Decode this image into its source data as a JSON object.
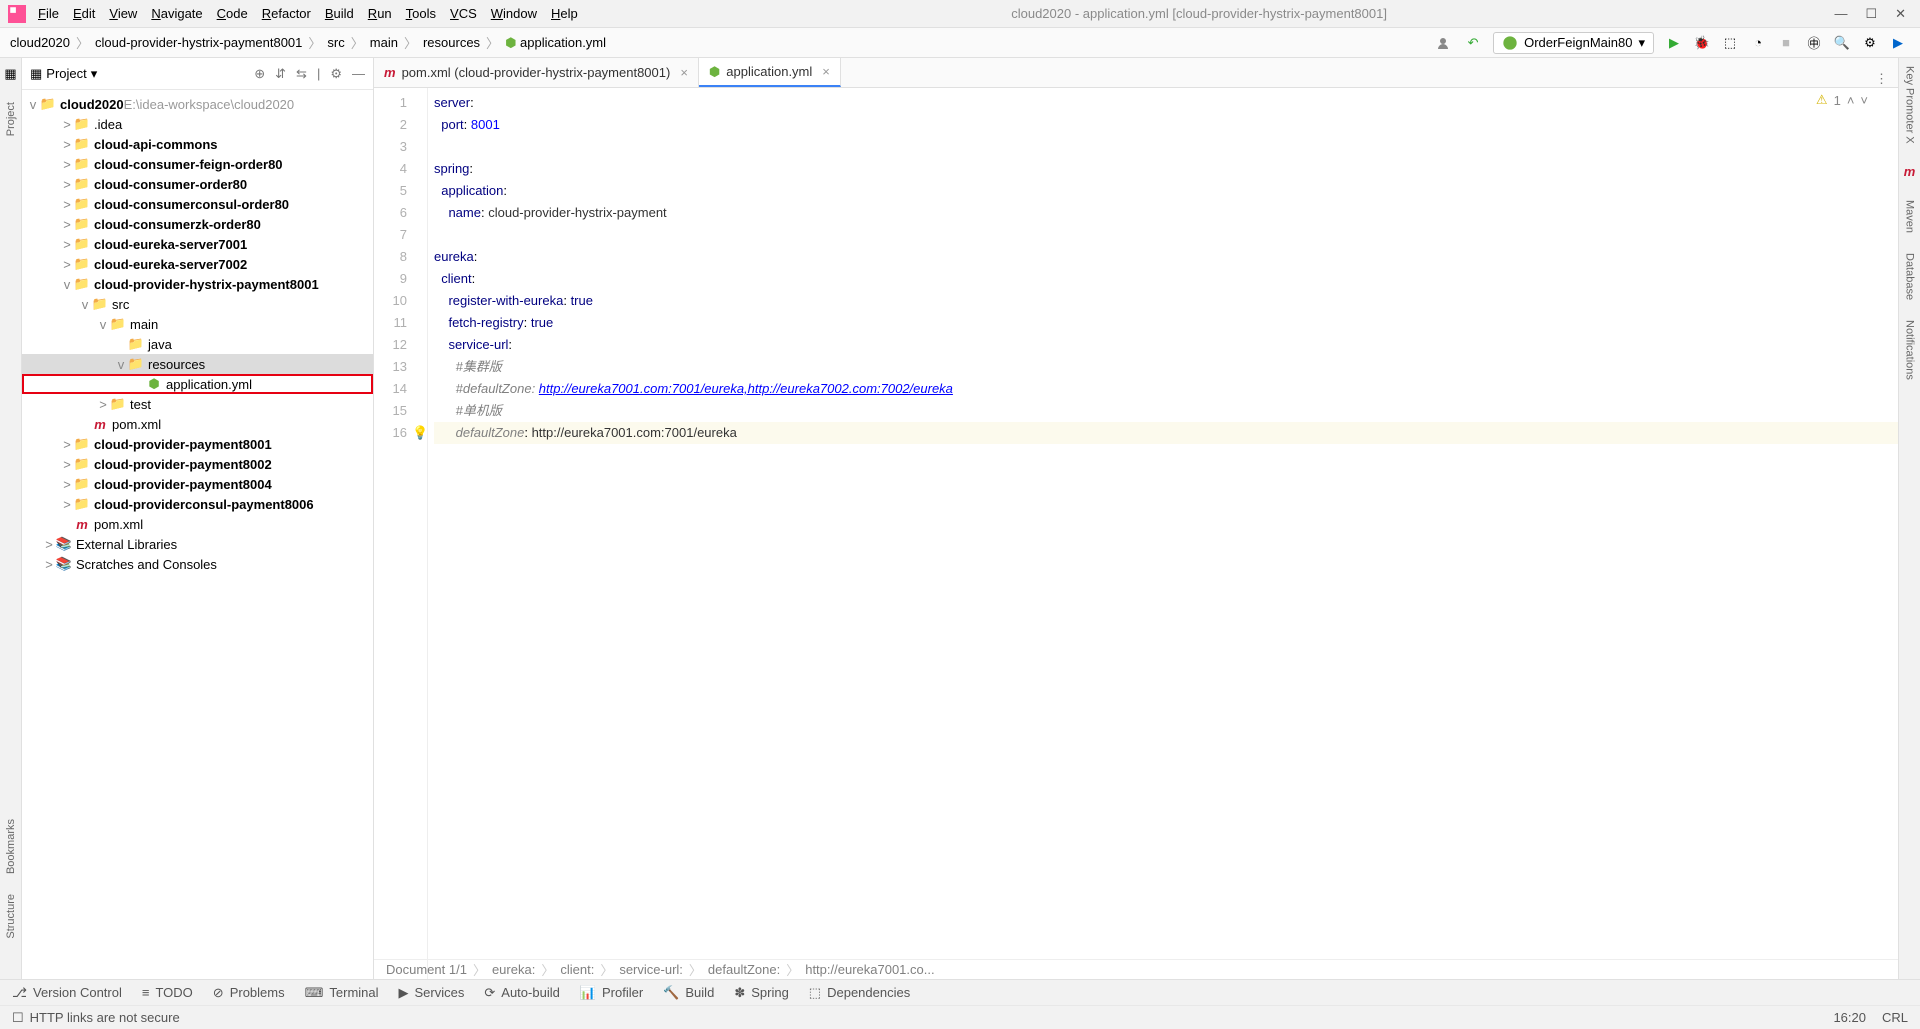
{
  "window": {
    "title": "cloud2020 - application.yml [cloud-provider-hystrix-payment8001]"
  },
  "menu": [
    "File",
    "Edit",
    "View",
    "Navigate",
    "Code",
    "Refactor",
    "Build",
    "Run",
    "Tools",
    "VCS",
    "Window",
    "Help"
  ],
  "breadcrumbs": [
    "cloud2020",
    "cloud-provider-hystrix-payment8001",
    "src",
    "main",
    "resources",
    "application.yml"
  ],
  "run_config": "OrderFeignMain80",
  "sidebar": {
    "title": "Project",
    "root": {
      "name": "cloud2020",
      "path": "E:\\idea-workspace\\cloud2020"
    },
    "items": [
      {
        "indent": 1,
        "arrow": ">",
        "name": ".idea",
        "bold": false
      },
      {
        "indent": 1,
        "arrow": ">",
        "name": "cloud-api-commons",
        "bold": true
      },
      {
        "indent": 1,
        "arrow": ">",
        "name": "cloud-consumer-feign-order80",
        "bold": true
      },
      {
        "indent": 1,
        "arrow": ">",
        "name": "cloud-consumer-order80",
        "bold": true
      },
      {
        "indent": 1,
        "arrow": ">",
        "name": "cloud-consumerconsul-order80",
        "bold": true
      },
      {
        "indent": 1,
        "arrow": ">",
        "name": "cloud-consumerzk-order80",
        "bold": true
      },
      {
        "indent": 1,
        "arrow": ">",
        "name": "cloud-eureka-server7001",
        "bold": true
      },
      {
        "indent": 1,
        "arrow": ">",
        "name": "cloud-eureka-server7002",
        "bold": true
      },
      {
        "indent": 1,
        "arrow": "v",
        "name": "cloud-provider-hystrix-payment8001",
        "bold": true
      },
      {
        "indent": 2,
        "arrow": "v",
        "name": "src",
        "bold": false
      },
      {
        "indent": 3,
        "arrow": "v",
        "name": "main",
        "bold": false
      },
      {
        "indent": 4,
        "arrow": "",
        "name": "java",
        "bold": false
      },
      {
        "indent": 4,
        "arrow": "v",
        "name": "resources",
        "bold": false,
        "sel": true
      },
      {
        "indent": 5,
        "arrow": "",
        "name": "application.yml",
        "bold": false,
        "hl": true,
        "file": "yml"
      },
      {
        "indent": 3,
        "arrow": ">",
        "name": "test",
        "bold": false
      },
      {
        "indent": 2,
        "arrow": "",
        "name": "pom.xml",
        "bold": false,
        "file": "pom"
      },
      {
        "indent": 1,
        "arrow": ">",
        "name": "cloud-provider-payment8001",
        "bold": true
      },
      {
        "indent": 1,
        "arrow": ">",
        "name": "cloud-provider-payment8002",
        "bold": true
      },
      {
        "indent": 1,
        "arrow": ">",
        "name": "cloud-provider-payment8004",
        "bold": true
      },
      {
        "indent": 1,
        "arrow": ">",
        "name": "cloud-providerconsul-payment8006",
        "bold": true
      },
      {
        "indent": 1,
        "arrow": "",
        "name": "pom.xml",
        "bold": false,
        "file": "pom"
      },
      {
        "indent": 0,
        "arrow": ">",
        "name": "External Libraries",
        "bold": false,
        "ext": true
      },
      {
        "indent": 0,
        "arrow": ">",
        "name": "Scratches and Consoles",
        "bold": false,
        "ext": true
      }
    ]
  },
  "tabs": [
    {
      "label": "pom.xml (cloud-provider-hystrix-payment8001)",
      "icon": "m",
      "active": false
    },
    {
      "label": "application.yml",
      "icon": "yml",
      "active": true
    }
  ],
  "editor": {
    "lines": [
      {
        "n": 1,
        "html": "<span class='k-key'>server</span>:"
      },
      {
        "n": 2,
        "html": "  <span class='k-key'>port</span>: <span class='k-num'>8001</span>"
      },
      {
        "n": 3,
        "html": ""
      },
      {
        "n": 4,
        "html": "<span class='k-key'>spring</span>:"
      },
      {
        "n": 5,
        "html": "  <span class='k-key'>application</span>:"
      },
      {
        "n": 6,
        "html": "    <span class='k-key'>name</span>: <span class='k-str'>cloud-provider-hystrix-payment</span>"
      },
      {
        "n": 7,
        "html": ""
      },
      {
        "n": 8,
        "html": "<span class='k-key'>eureka</span>:"
      },
      {
        "n": 9,
        "html": "  <span class='k-key'>client</span>:"
      },
      {
        "n": 10,
        "html": "    <span class='k-key'>register-with-eureka</span>: <span class='k-bool'>true</span>"
      },
      {
        "n": 11,
        "html": "    <span class='k-key'>fetch-registry</span>: <span class='k-bool'>true</span>"
      },
      {
        "n": 12,
        "html": "    <span class='k-key'>service-url</span>:"
      },
      {
        "n": 13,
        "html": "      <span class='k-cmt'>#集群版</span>"
      },
      {
        "n": 14,
        "html": "      <span class='k-cmt'>#defaultZone: </span><span class='k-link'>http://eureka7001.com:7001/eureka,http://eureka7002.com:7002/eureka</span>"
      },
      {
        "n": 15,
        "html": "      <span class='k-cmt'>#单机版</span>"
      },
      {
        "n": 16,
        "html": "      <span class='k-key-i'>defaultZone</span>: <span class='k-str'>http://eureka7001.com:7001/eureka</span>",
        "caret": true
      }
    ],
    "warning_count": "1"
  },
  "editor_status": [
    "Document 1/1",
    "eureka:",
    "client:",
    "service-url:",
    "defaultZone:",
    "http://eureka7001.co..."
  ],
  "bottom": [
    "Version Control",
    "TODO",
    "Problems",
    "Terminal",
    "Services",
    "Auto-build",
    "Profiler",
    "Build",
    "Spring",
    "Dependencies"
  ],
  "status": {
    "left": "HTTP links are not secure",
    "time": "16:20",
    "enc": "CRL"
  },
  "left_tools": [
    "Project",
    "Bookmarks",
    "Structure"
  ],
  "right_tools": [
    "Key Promoter X",
    "Maven",
    "Database",
    "Notifications"
  ]
}
